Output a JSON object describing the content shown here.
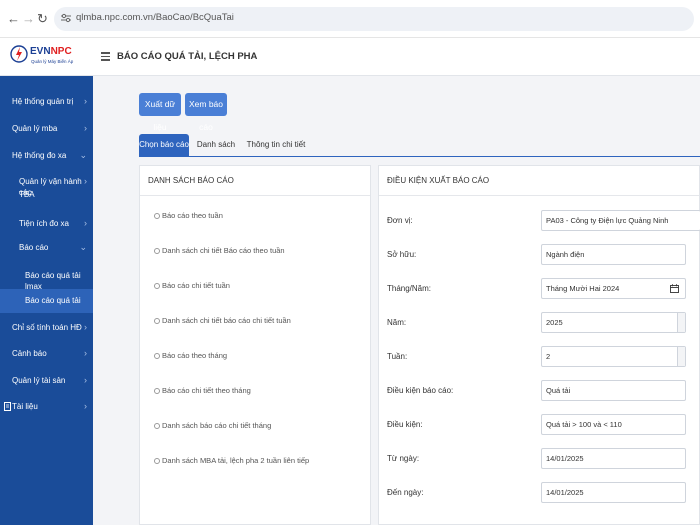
{
  "browser": {
    "back_icon": "arrow-left-icon",
    "forward_icon": "arrow-right-icon",
    "reload_icon": "reload-icon",
    "url": "qlmba.npc.com.vn/BaoCao/BcQuaTai"
  },
  "logo": {
    "brand_main": "EVN",
    "brand_accent": "NPC",
    "subtitle": "Quản lý Máy Biến Áp"
  },
  "header": {
    "title": "BÁO CÁO QUÁ TẢI, LỆCH PHA"
  },
  "sidebar": {
    "items": [
      {
        "label": "Hệ thống quản trị",
        "chevron": "›"
      },
      {
        "label": "Quản lý mba",
        "chevron": "›"
      },
      {
        "label": "Hệ thống đo xa",
        "chevron": "⌄"
      },
      {
        "label": "Quản lý vận hành các",
        "label2": "TBA",
        "chevron": "›"
      },
      {
        "label": "Tiện ích đo xa",
        "chevron": "›"
      },
      {
        "label": "Báo cáo",
        "chevron": "⌄"
      },
      {
        "label": "Báo cáo quá tải lmax"
      },
      {
        "label": "Báo cáo quá tải"
      },
      {
        "label": "Chỉ số tính toán HĐ",
        "chevron": "›"
      },
      {
        "label": "Cảnh báo",
        "chevron": "›"
      },
      {
        "label": "Quản lý tài sản",
        "chevron": "›"
      },
      {
        "label": "Tài liệu",
        "chevron": "›"
      }
    ]
  },
  "toolbar": {
    "export_label": "Xuất dữ liệu",
    "view_label": "Xem báo cáo"
  },
  "tabs": [
    {
      "label": "Chọn báo cáo",
      "active": true
    },
    {
      "label": "Danh sách",
      "active": false
    },
    {
      "label": "Thông tin chi tiết",
      "active": false
    }
  ],
  "report_list": {
    "heading": "DANH SÁCH BÁO CÁO",
    "items": [
      "Báo cáo theo tuần",
      "Danh sách chi tiết Báo cáo theo tuần",
      "Báo cáo chi tiết tuần",
      "Danh sách chi tiết báo cáo chi tiết tuần",
      "Báo cáo theo tháng",
      "Báo cáo chi tiết theo tháng",
      "Danh sách báo cáo chi tiết tháng",
      "Danh sách MBA tải, lệch pha 2 tuần liên tiếp"
    ]
  },
  "conditions": {
    "heading": "ĐIỀU KIỆN XUẤT BÁO CÁO",
    "fields": [
      {
        "label": "Đơn vị:",
        "value": "PA03 - Công ty Điện lực Quảng Ninh"
      },
      {
        "label": "Sở hữu:",
        "value": "Ngành điện"
      },
      {
        "label": "Tháng/Năm:",
        "value": "Tháng Mười Hai 2024"
      },
      {
        "label": "Năm:",
        "value": "2025"
      },
      {
        "label": "Tuần:",
        "value": "2"
      },
      {
        "label": "Điều kiện báo cáo:",
        "value": "Quá tải"
      },
      {
        "label": "Điều kiện:",
        "value": "Quá tải > 100 và < 110"
      },
      {
        "label": "Từ ngày:",
        "value": "14/01/2025"
      },
      {
        "label": "Đến ngày:",
        "value": "14/01/2025"
      }
    ]
  },
  "colors": {
    "sidebar": "#1a4c99",
    "accent": "#4a7fd6",
    "brand_red": "#e02020"
  }
}
